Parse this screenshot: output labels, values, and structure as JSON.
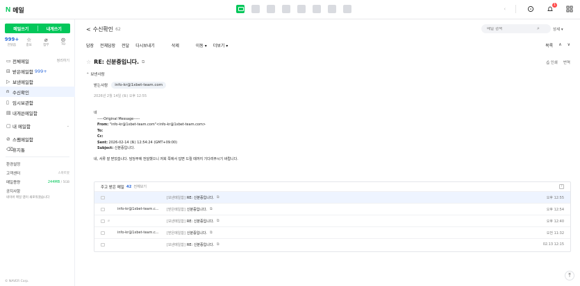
{
  "topbar": {
    "logo_mark": "N",
    "logo_text": "메일",
    "apps": [
      "mail",
      "calendar",
      "contacts",
      "notes",
      "photos",
      "drive",
      "calendar2",
      "bookmarks"
    ],
    "chevron": "‹",
    "notification_badge": "1"
  },
  "sidebar": {
    "write_label": "메일쓰기",
    "self_label": "내게쓰기",
    "quick": [
      {
        "value": "999+",
        "icon": "none",
        "label": "안읽음"
      },
      {
        "value": "",
        "icon": "star-icon",
        "label": "중요"
      },
      {
        "value": "",
        "icon": "paperclip-icon",
        "label": "첨부"
      },
      {
        "value": "",
        "icon": "to-me-icon",
        "label": "TO"
      }
    ],
    "items": [
      {
        "label": "전체메일",
        "right": "정리하기",
        "count": ""
      },
      {
        "label": "받은메일함",
        "right": "",
        "count": "999+"
      },
      {
        "label": "보낸메일함",
        "right": "",
        "count": ""
      },
      {
        "label": "수신확인",
        "right": "",
        "count": ""
      },
      {
        "label": "임시보관함",
        "right": "",
        "count": ""
      },
      {
        "label": "내게쓴메일함",
        "right": "",
        "count": ""
      },
      {
        "label": "내 메일함",
        "right": "",
        "count": ""
      },
      {
        "label": "스팸메일함",
        "right": "",
        "count": ""
      },
      {
        "label": "휴지통",
        "right": "",
        "count": ""
      }
    ],
    "settings": "환경설정",
    "customer_center": "고객센터",
    "customer_right": "스마트봇",
    "capacity_label": "메일용량",
    "capacity_used": "244MB",
    "capacity_sep": "/",
    "capacity_total": "5GB",
    "notice_title": "공지사항",
    "notice_text": "네이버 메일 앱이 새로워졌습니다",
    "copyright": "© NAVER Corp."
  },
  "main": {
    "back": "<",
    "folder": "수신확인",
    "folder_count": "62",
    "search_placeholder": "메일 검색",
    "detail": "상세 ▾",
    "toolbar": [
      "답장",
      "전체답장",
      "전달",
      "다시보내기",
      "삭제",
      "이동 ▾",
      "더보기 ▾"
    ],
    "toolbar_right": [
      "목록",
      "∧",
      "∨"
    ],
    "subject": "RE: 신분증입니다.",
    "subject_right": [
      "인쇄",
      "번역"
    ],
    "toggle": "보낸사람",
    "to_label": "받는사람",
    "to_value": "info-kr@1xbet-team.com",
    "date": "2026년 2월 14일 (토) 오후 12:55",
    "body": {
      "greeting": "네",
      "orig_head": "-----Original Message-----",
      "from_label": "From:",
      "from_value": " \"info-kr@1xbet-team.com\"<info-kr@1xbet-team.com>",
      "to_label": "To:",
      "cc_label": "Cc:",
      "sent_label": "Sent:",
      "sent_value": " 2026-02-14 (토) 12:54:24 (GMT+09:00)",
      "subject_label": "Subject:",
      "subject_value": " 신분증입니다.",
      "reply": "네, 서류 잘 받았습니다. 담당부에 전달했으니 저희 쪽에서 답변 드릴 때까지 기다려주시기 바랍니다."
    },
    "reply_box": {
      "title": "주고 받은 메일",
      "count": "42",
      "all": "전체보기",
      "help": "?",
      "rows": [
        {
          "from": "",
          "folder": "[보낸메일함]",
          "subject": "RE: 신분증입니다.",
          "time": "오후 12:55",
          "selected": true,
          "attach": false
        },
        {
          "from": "info-kr@1xbet-team.c...",
          "folder": "[받은메일함]",
          "subject": "신분증입니다.",
          "time": "오후 12:54",
          "selected": false,
          "attach": false
        },
        {
          "from": "",
          "folder": "[보낸메일함]",
          "subject": "RE: 신분증입니다.",
          "time": "오후 12:40",
          "selected": false,
          "attach": true
        },
        {
          "from": "info-kr@1xbet-team.c...",
          "folder": "[받은메일함]",
          "subject": "신분증입니다.",
          "time": "오전 11:32",
          "selected": false,
          "attach": false
        },
        {
          "from": "",
          "folder": "[보낸메일함]",
          "subject": "RE: 신분증입니다.",
          "time": "02.13 12:15",
          "selected": false,
          "attach": false
        }
      ]
    },
    "top_button": "⤒"
  }
}
